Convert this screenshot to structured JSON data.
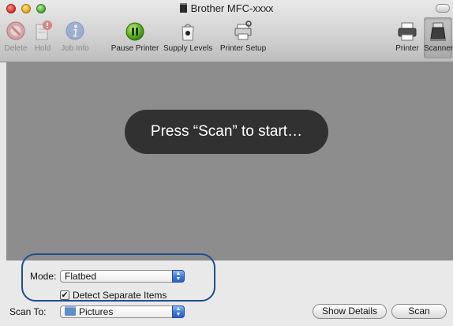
{
  "window": {
    "title": "Brother MFC-xxxx"
  },
  "toolbar": {
    "items": [
      {
        "label": "Delete",
        "icon": "delete-icon",
        "enabled": false
      },
      {
        "label": "Hold",
        "icon": "hold-icon",
        "enabled": false
      },
      {
        "label": "Job Info",
        "icon": "info-icon",
        "enabled": false
      },
      {
        "label": "Pause Printer",
        "icon": "pause-icon",
        "enabled": true
      },
      {
        "label": "Supply Levels",
        "icon": "supply-levels-icon",
        "enabled": true
      },
      {
        "label": "Printer Setup",
        "icon": "printer-setup-icon",
        "enabled": true
      },
      {
        "label": "Printer",
        "icon": "printer-icon",
        "enabled": true
      },
      {
        "label": "Scanner",
        "icon": "scanner-icon",
        "enabled": true,
        "selected": true
      }
    ]
  },
  "preview": {
    "message": "Press “Scan” to start…"
  },
  "controls": {
    "mode_label": "Mode:",
    "mode_value": "Flatbed",
    "detect_label": "Detect Separate Items",
    "detect_checked": true,
    "scan_to_label": "Scan To:",
    "scan_to_value": "Pictures",
    "show_details_label": "Show Details",
    "scan_label": "Scan"
  },
  "colors": {
    "preview_bg": "#8d8d8d",
    "hud_bg": "#2d2d2d",
    "highlight": "#1f4f92",
    "accent": "#3d78d8"
  }
}
